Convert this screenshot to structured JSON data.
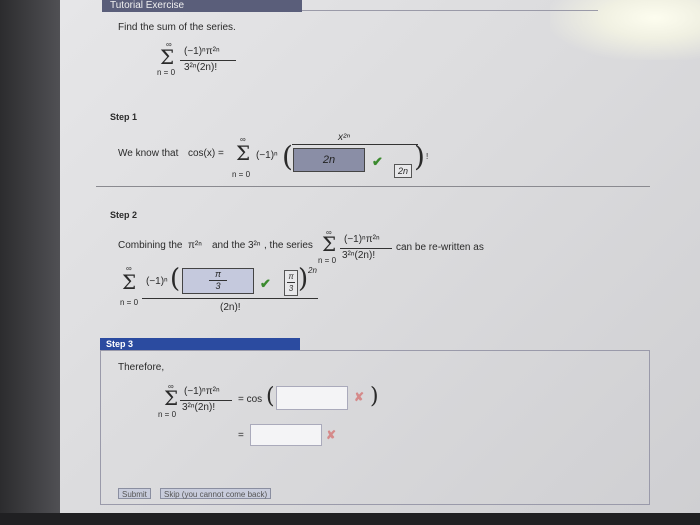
{
  "tutorial": {
    "title": "Tutorial Exercise"
  },
  "problem": {
    "prompt": "Find the sum of the series.",
    "sum_top": "∞",
    "sum_bottom": "n = 0",
    "numerator": "(−1)ⁿπ²ⁿ",
    "denominator": "3²ⁿ(2n)!"
  },
  "step1": {
    "header": "Step 1",
    "text": "We know that",
    "cos_expr": "cos(x) =",
    "sum_top": "∞",
    "sum_bottom": "n = 0",
    "sign": "(−1)ⁿ",
    "power_label": "x²ⁿ",
    "answer_value": "2n",
    "small_box_value": "2n",
    "suffix": "!"
  },
  "step2": {
    "header": "Step 2",
    "text_a": "Combining the",
    "pi_term": "π²ⁿ",
    "text_b": "and the",
    "three_term": "3²ⁿ",
    "text_c": ", the series",
    "sum_top": "∞",
    "sum_bottom": "n = 0",
    "numerator": "(−1)ⁿπ²ⁿ",
    "denominator": "3²ⁿ(2n)!",
    "text_d": "can be re-written as",
    "sign": "(−1)ⁿ",
    "answer_num": "π",
    "answer_den": "3",
    "small_num": "π",
    "small_den": "3",
    "power": "2n",
    "denominator2": "(2n)!"
  },
  "step3": {
    "header": "Step 3",
    "text": "Therefore,",
    "sum_top": "∞",
    "sum_bottom": "n = 0",
    "numerator": "(−1)ⁿπ²ⁿ",
    "denominator": "3²ⁿ(2n)!",
    "eq_cos": "= cos",
    "eq": "=",
    "input1_value": "",
    "input2_value": ""
  },
  "buttons": {
    "submit": "Submit",
    "skip": "Skip (you cannot come back)"
  }
}
